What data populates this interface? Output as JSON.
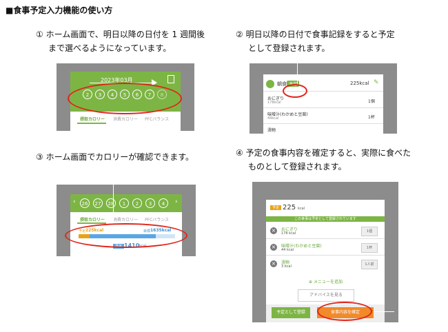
{
  "heading": "■食事予定入力機能の使い方",
  "steps": {
    "s1_line1": "①  ホーム画面で、明日以降の日付を 1 週間後",
    "s1_line2": "まで選べるようになっています。",
    "s2_line1": "②  明日以降の日付で食事記録をすると予定",
    "s2_line2": "として登録されます。",
    "s3_line1": "③  ホーム画面でカロリーが確認できます。",
    "s4_line1": "④  予定の食事内容を確定すると、実際に食べた",
    "s4_line2": "ものとして登録されます。"
  },
  "screen1": {
    "month": "2023年03月",
    "days": [
      "2",
      "3",
      "4",
      "5",
      "6",
      "7",
      "8"
    ],
    "tabs": [
      "摂取カロリー",
      "消費カロリー",
      "PFCバランス"
    ]
  },
  "screen2": {
    "meal": "朝食",
    "badge": "予定",
    "total": "225kcal",
    "items": [
      {
        "name": "おにぎり",
        "kcal": "178kcal",
        "qty": "1個"
      },
      {
        "name": "味噌汁(わかめと豆腐)",
        "kcal": "44kcal",
        "qty": "1杯"
      },
      {
        "name": "漬物",
        "kcal": "",
        "qty": ""
      }
    ]
  },
  "screen3": {
    "days": [
      "26",
      "27",
      "28",
      "1",
      "2",
      "3",
      "4"
    ],
    "tabs": [
      "摂取カロリー",
      "消費カロリー",
      "PFCバランス"
    ],
    "left_label": "予定",
    "left_value": "225kcal",
    "right_label": "目標",
    "right_value": "1635kcal",
    "bottom_badge": "予定",
    "bottom_value": "1410",
    "bottom_unit": "kcal"
  },
  "screen4": {
    "badge": "予定",
    "total": "225",
    "unit": "kcal",
    "notice": "この食事は予定として登録されています",
    "items": [
      {
        "name": "おにぎり",
        "kcal": "178 kcal",
        "unit": "1個"
      },
      {
        "name": "味噌汁(わかめと豆腐)",
        "kcal": "44 kcal",
        "unit": "1杯"
      },
      {
        "name": "漬物",
        "kcal": "3 kcal",
        "unit": "1人前"
      }
    ],
    "add_menu": "メニューを追加",
    "advice": "アドバイスを見る",
    "save_plan": "予定として登録",
    "confirm": "食事内容を確定"
  }
}
